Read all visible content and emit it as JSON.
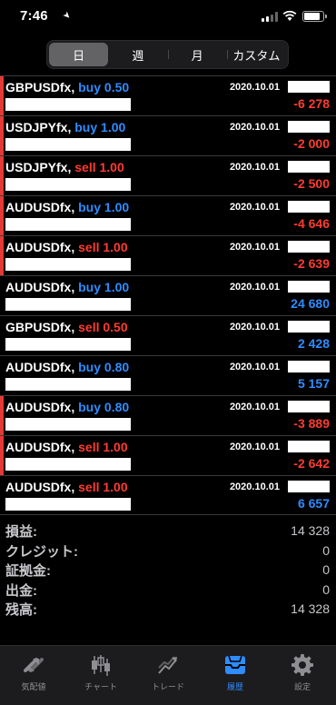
{
  "status": {
    "time": "7:46"
  },
  "tabs": [
    "日",
    "週",
    "月",
    "カスタム"
  ],
  "rows": [
    {
      "symbol": "GBPUSDfx,",
      "side": "buy",
      "volume_text": "buy 0.50",
      "date": "2020.10.01",
      "profit": "-6 278",
      "loss": true
    },
    {
      "symbol": "USDJPYfx,",
      "side": "buy",
      "volume_text": "buy 1.00",
      "date": "2020.10.01",
      "profit": "-2 000",
      "loss": true
    },
    {
      "symbol": "USDJPYfx,",
      "side": "sell",
      "volume_text": "sell 1.00",
      "date": "2020.10.01",
      "profit": "-2 500",
      "loss": true
    },
    {
      "symbol": "AUDUSDfx,",
      "side": "buy",
      "volume_text": "buy 1.00",
      "date": "2020.10.01",
      "profit": "-4 646",
      "loss": true
    },
    {
      "symbol": "AUDUSDfx,",
      "side": "sell",
      "volume_text": "sell 1.00",
      "date": "2020.10.01",
      "profit": "-2 639",
      "loss": true
    },
    {
      "symbol": "AUDUSDfx,",
      "side": "buy",
      "volume_text": "buy 1.00",
      "date": "2020.10.01",
      "profit": "24 680",
      "loss": false
    },
    {
      "symbol": "GBPUSDfx,",
      "side": "sell",
      "volume_text": "sell 0.50",
      "date": "2020.10.01",
      "profit": "2 428",
      "loss": false
    },
    {
      "symbol": "AUDUSDfx,",
      "side": "buy",
      "volume_text": "buy 0.80",
      "date": "2020.10.01",
      "profit": "5 157",
      "loss": false
    },
    {
      "symbol": "AUDUSDfx,",
      "side": "buy",
      "volume_text": "buy 0.80",
      "date": "2020.10.01",
      "profit": "-3 889",
      "loss": true
    },
    {
      "symbol": "AUDUSDfx,",
      "side": "sell",
      "volume_text": "sell 1.00",
      "date": "2020.10.01",
      "profit": "-2 642",
      "loss": true
    },
    {
      "symbol": "AUDUSDfx,",
      "side": "sell",
      "volume_text": "sell 1.00",
      "date": "2020.10.01",
      "profit": "6 657",
      "loss": false
    }
  ],
  "summary": [
    {
      "label": "損益:",
      "value": "14 328"
    },
    {
      "label": "クレジット:",
      "value": "0"
    },
    {
      "label": "証拠金:",
      "value": "0"
    },
    {
      "label": "出金:",
      "value": "0"
    },
    {
      "label": "残高:",
      "value": "14 328"
    }
  ],
  "tabbar": [
    {
      "label": "気配値",
      "icon": "quotes-icon",
      "active": false
    },
    {
      "label": "チャート",
      "icon": "chart-icon",
      "active": false
    },
    {
      "label": "トレード",
      "icon": "trade-icon",
      "active": false
    },
    {
      "label": "履歴",
      "icon": "history-icon",
      "active": true
    },
    {
      "label": "設定",
      "icon": "settings-icon",
      "active": false
    }
  ],
  "colors": {
    "buy": "#2f8cff",
    "sell": "#ff3b30",
    "loss_bar": "#e53935",
    "active_tab": "#2f8cff"
  }
}
